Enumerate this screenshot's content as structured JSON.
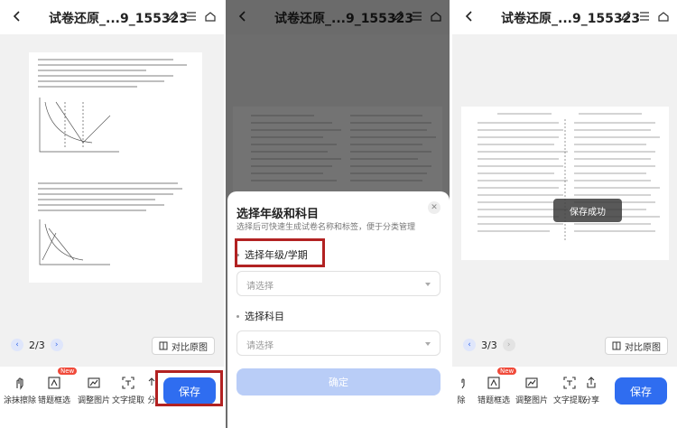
{
  "panels": [
    {
      "title": "试卷还原_...9_155323",
      "pager": {
        "current": "2/3"
      },
      "compare_label": "对比原图",
      "tools": [
        "涂抹擦除",
        "错题框选",
        "调整图片",
        "文字提取",
        "分"
      ],
      "new_badge": "New",
      "save_label": "保存"
    },
    {
      "title": "试卷还原_...9_155323",
      "dialog": {
        "title": "选择年级和科目",
        "subtitle": "选择后可快速生成试卷名称和标签，便于分类管理",
        "grade_label": "选择年级/学期",
        "grade_placeholder": "请选择",
        "subject_label": "选择科目",
        "subject_placeholder": "请选择",
        "confirm_label": "确定"
      }
    },
    {
      "title": "试卷还原_...9_155323",
      "pager": {
        "current": "3/3"
      },
      "compare_label": "对比原图",
      "toast": "保存成功",
      "tools": [
        "除",
        "错题框选",
        "调整图片",
        "文字提取",
        "分享"
      ],
      "new_badge": "New",
      "save_label": "保存"
    }
  ],
  "colors": {
    "accent": "#2f6df0",
    "highlight": "#b22222",
    "badge": "#f04a3a"
  }
}
